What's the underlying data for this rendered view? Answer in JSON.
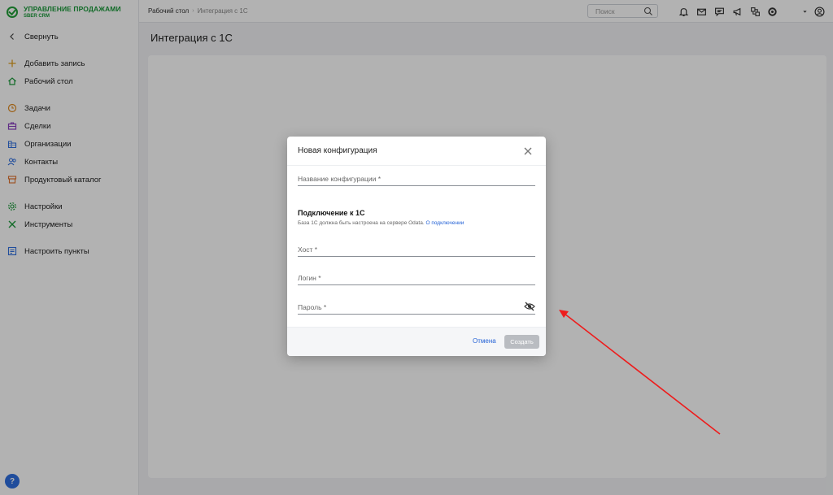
{
  "brand": {
    "title": "УПРАВЛЕНИЕ ПРОДАЖАМИ",
    "subtitle": "SBER CRM"
  },
  "sidebar": {
    "collapse_label": "Свернуть",
    "items": [
      {
        "label": "Добавить запись",
        "icon": "plus-icon"
      },
      {
        "label": "Рабочий стол",
        "icon": "home-icon"
      },
      {
        "label": "Задачи",
        "icon": "clock-icon"
      },
      {
        "label": "Сделки",
        "icon": "briefcase-icon"
      },
      {
        "label": "Организации",
        "icon": "building-icon"
      },
      {
        "label": "Контакты",
        "icon": "people-icon"
      },
      {
        "label": "Продуктовый каталог",
        "icon": "box-icon"
      },
      {
        "label": "Настройки",
        "icon": "gear-icon"
      },
      {
        "label": "Инструменты",
        "icon": "tools-icon"
      },
      {
        "label": "Настроить пункты",
        "icon": "layout-icon"
      }
    ],
    "help_label": "?"
  },
  "topbar": {
    "breadcrumbs": [
      "Рабочий стол",
      "Интеграция с 1С"
    ],
    "search_placeholder": "Поиск"
  },
  "page": {
    "title": "Интеграция с 1С"
  },
  "modal": {
    "title": "Новая конфигурация",
    "config_name_placeholder": "Название конфигурации *",
    "section_title": "Подключение к 1С",
    "section_note": "База 1С должна быть настроена на сервере Odata.",
    "section_link": "О подключении",
    "host_placeholder": "Хост *",
    "login_placeholder": "Логин *",
    "password_placeholder": "Пароль *",
    "cancel_label": "Отмена",
    "create_label": "Создать"
  },
  "colors": {
    "brand_green": "#21a038",
    "link_blue": "#2462d6",
    "disabled_button": "#b9bcc1",
    "annotation_arrow": "#ee1c1c"
  }
}
